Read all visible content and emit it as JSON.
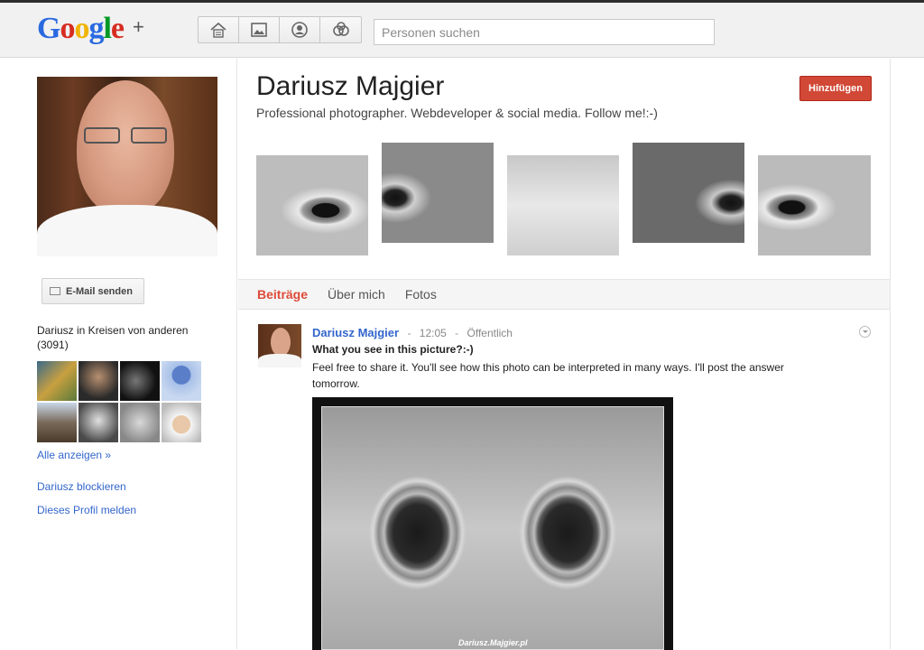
{
  "header": {
    "logo_text": "Google",
    "logo_plus": "+",
    "search_placeholder": "Personen suchen",
    "nav_icons": [
      "home-icon",
      "photos-icon",
      "profile-icon",
      "circles-icon"
    ]
  },
  "sidebar": {
    "send_email_label": "E-Mail senden",
    "circles_title": "Dariusz in Kreisen von anderen (3091)",
    "show_all_label": "Alle anzeigen »",
    "block_label": "Dariusz blockieren",
    "report_label": "Dieses Profil melden"
  },
  "profile": {
    "name": "Dariusz Majgier",
    "tagline": "Professional photographer. Webdeveloper & social media. Follow me!:-)",
    "add_button": "Hinzufügen"
  },
  "tabs": [
    {
      "label": "Beiträge",
      "active": true
    },
    {
      "label": "Über mich",
      "active": false
    },
    {
      "label": "Fotos",
      "active": false
    }
  ],
  "post": {
    "author": "Dariusz Majgier",
    "time": "12:05",
    "visibility": "Öffentlich",
    "title": "What you see in this picture?:-)",
    "text": "Feel free to share it. You'll see how this photo can be interpreted in many ways. I'll post the answer tomorrow.",
    "image_watermark": "Dariusz.Majgier.pl"
  },
  "colors": {
    "accent_red": "#dd4b39",
    "add_button": "#d14836",
    "link_blue": "#3366cc"
  }
}
